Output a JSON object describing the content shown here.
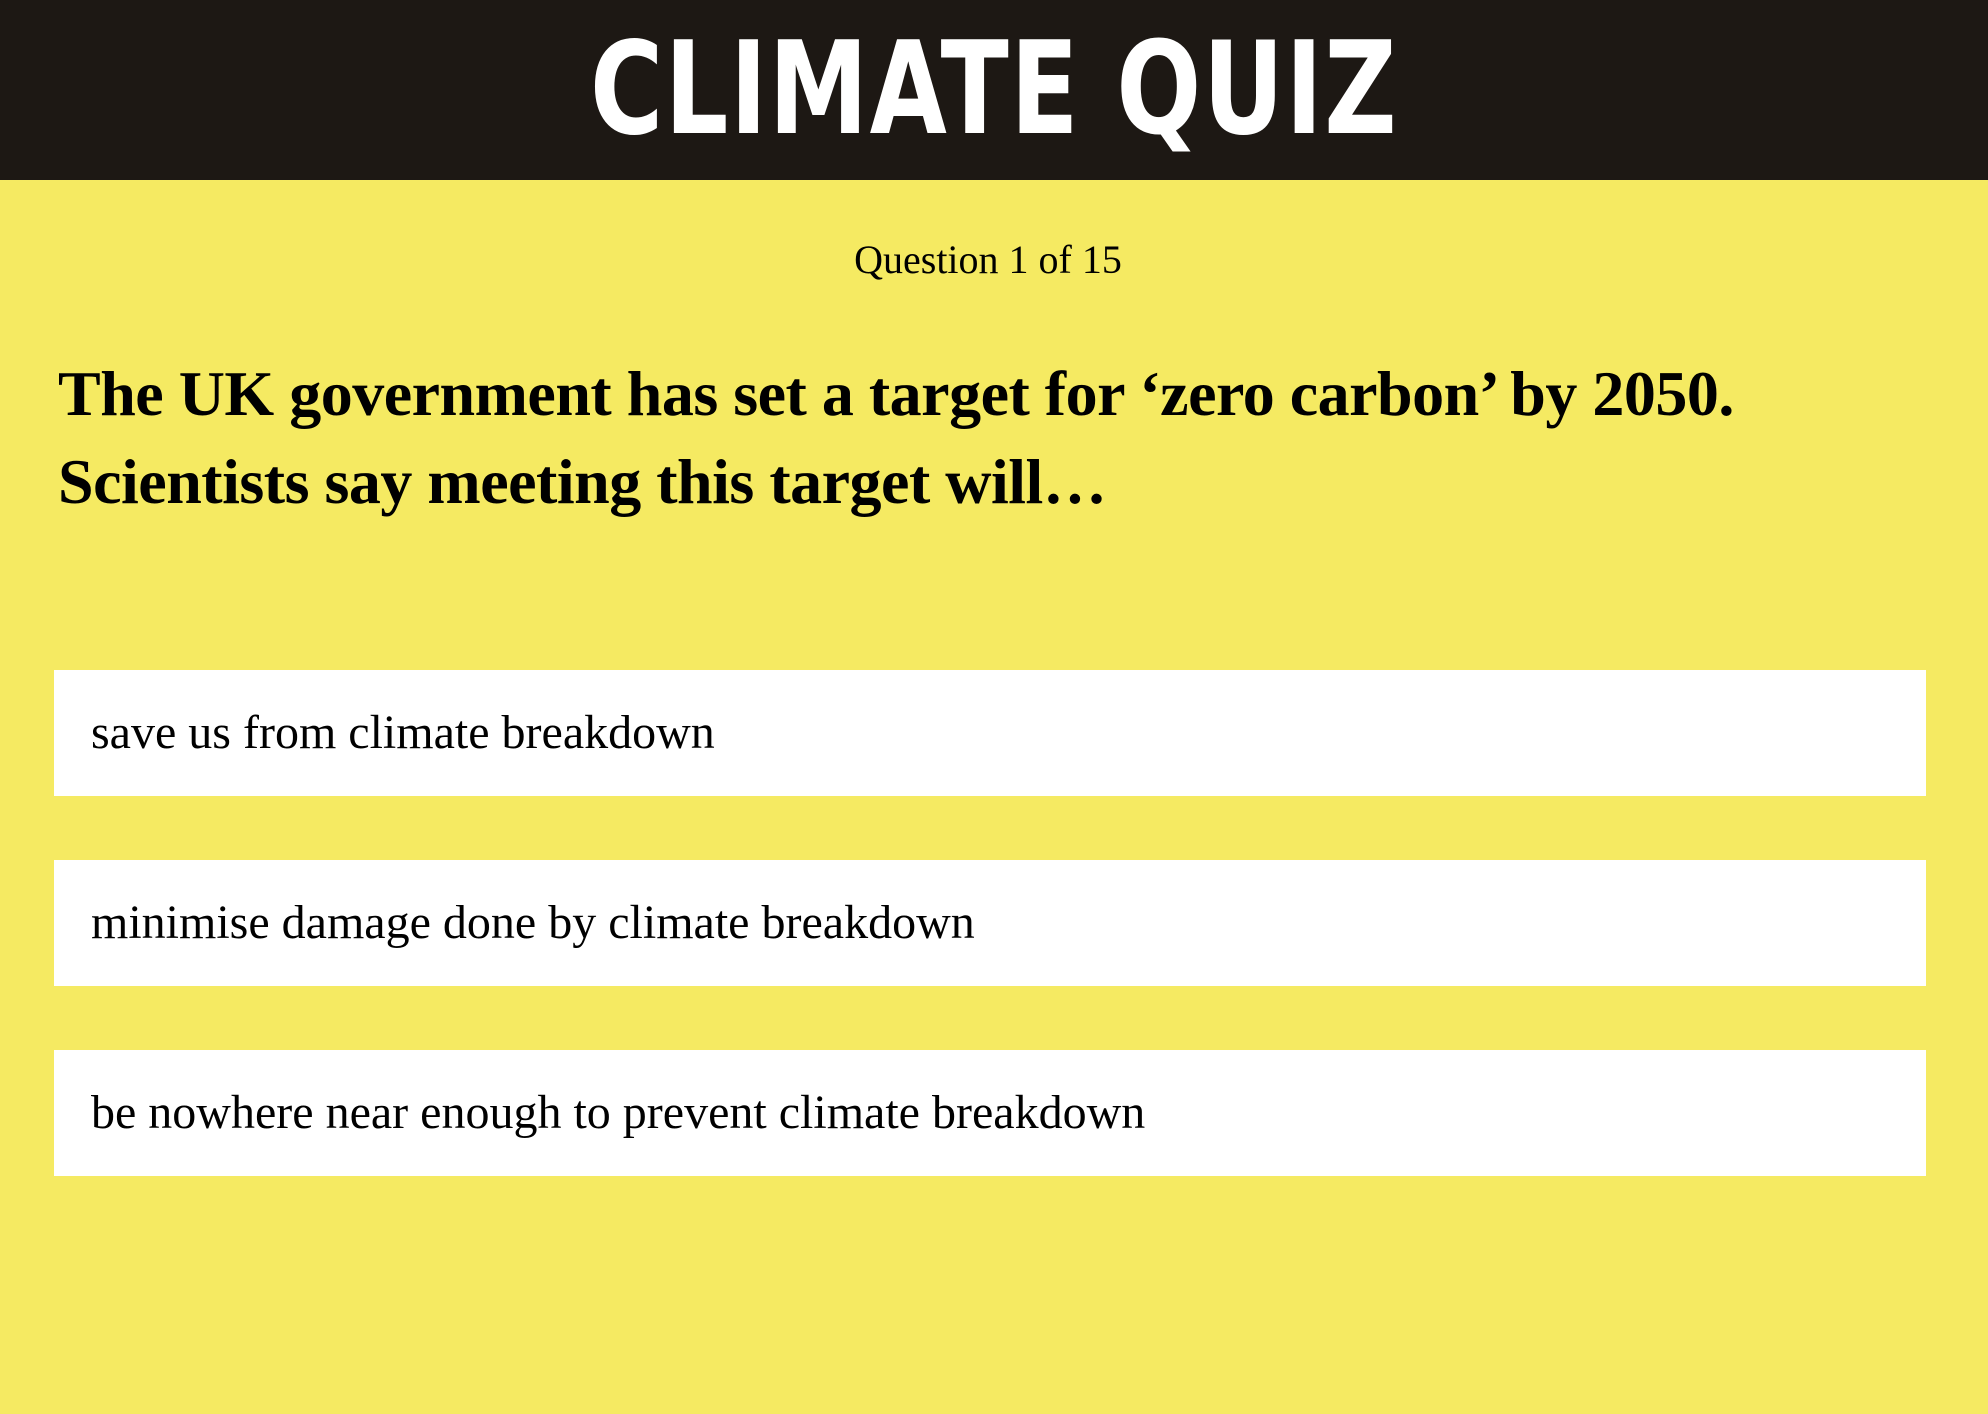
{
  "header": {
    "title": "CLIMATE QUIZ"
  },
  "quiz": {
    "counter": "Question 1 of 15",
    "question_line1": "The UK government has set a target for ‘zero carbon’ by 2050.",
    "question_line2": "Scientists say meeting this target will…",
    "answers": [
      {
        "label": "save us from climate breakdown"
      },
      {
        "label": "minimise damage done by climate breakdown"
      },
      {
        "label": "be nowhere near enough to prevent climate breakdown"
      }
    ]
  },
  "colors": {
    "background": "#f5ea62",
    "header_background": "#1d1814",
    "answer_background": "#ffffff"
  }
}
